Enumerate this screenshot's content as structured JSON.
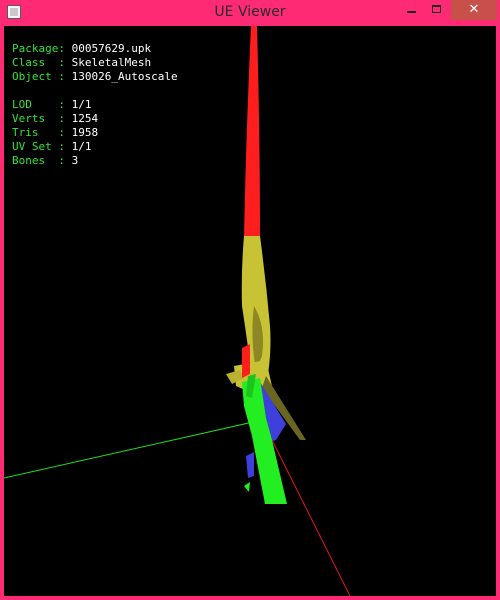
{
  "window": {
    "title": "UE Viewer",
    "icons": {
      "app": "app-icon",
      "minimize": "minimize-icon",
      "maximize": "maximize-icon",
      "close": "close-icon"
    },
    "close_glyph": "✕"
  },
  "info": {
    "package": {
      "label": "Package",
      "value": "00057629.upk"
    },
    "class": {
      "label": "Class  ",
      "value": "SkeletalMesh"
    },
    "object": {
      "label": "Object ",
      "value": "130026_Autoscale"
    },
    "lod": {
      "label": "LOD    ",
      "value": "1/1"
    },
    "verts": {
      "label": "Verts  ",
      "value": "1254"
    },
    "tris": {
      "label": "Tris   ",
      "value": "1958"
    },
    "uvset": {
      "label": "UV Set ",
      "value": "1/1"
    },
    "bones": {
      "label": "Bones  ",
      "value": "3"
    }
  },
  "colors": {
    "frame": "#ff2a74",
    "viewport_bg": "#000000",
    "label": "#35e335",
    "value": "#ffffff",
    "mesh_red": "#ff1e1e",
    "mesh_yellow": "#c8c235",
    "mesh_green": "#22ee22",
    "mesh_blue": "#3f3fdc",
    "axis_x": "#e01818",
    "axis_y": "#1fdd1f"
  }
}
